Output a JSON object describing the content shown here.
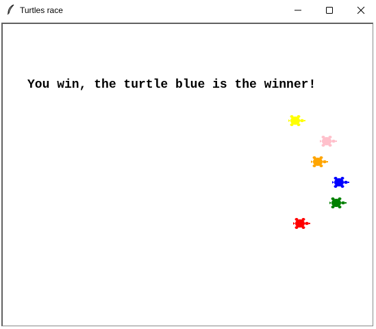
{
  "window": {
    "title": "Turtles race"
  },
  "controls": {
    "minimize_icon": "minimize-icon",
    "maximize_icon": "maximize-icon",
    "close_icon": "close-icon"
  },
  "canvas": {
    "message": "You win, the turtle blue is the winner!"
  },
  "turtles": [
    {
      "color_name": "yellow",
      "color": "#ffff00"
    },
    {
      "color_name": "pink",
      "color": "#ffc0cb"
    },
    {
      "color_name": "orange",
      "color": "#ffa500"
    },
    {
      "color_name": "blue",
      "color": "#0000ff"
    },
    {
      "color_name": "green",
      "color": "#008000"
    },
    {
      "color_name": "red",
      "color": "#ff0000"
    }
  ]
}
